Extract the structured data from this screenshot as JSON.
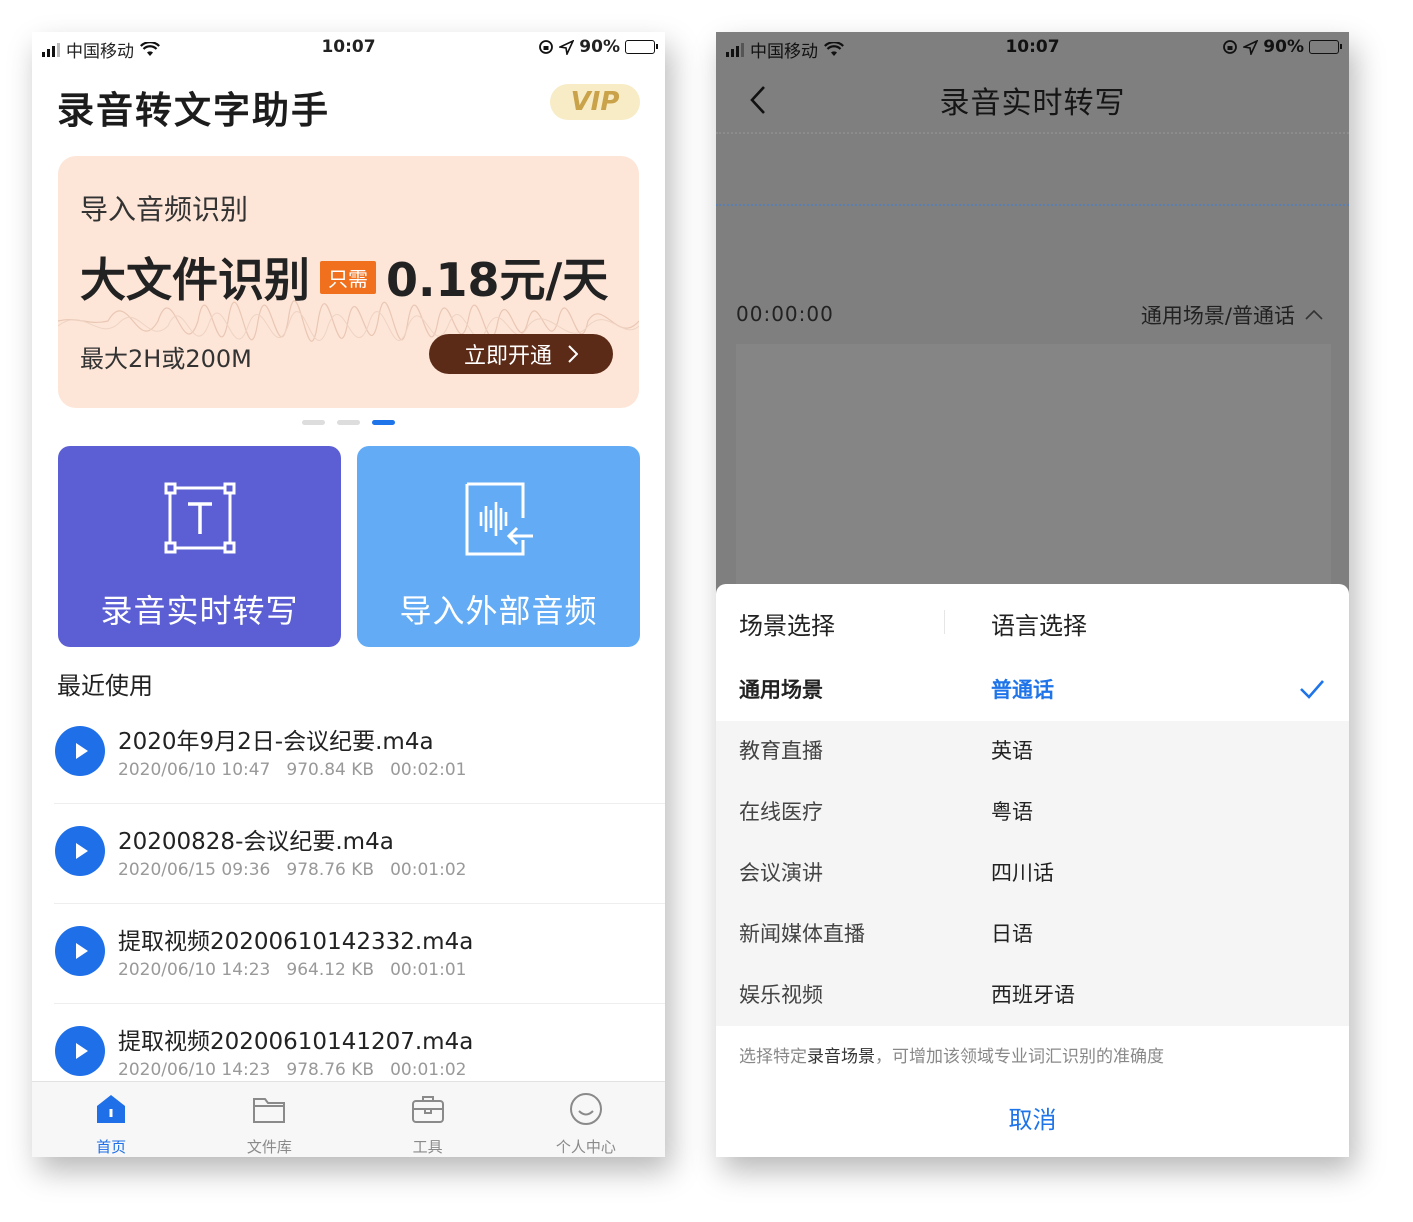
{
  "status_bar": {
    "carrier": "中国移动",
    "time": "10:07",
    "battery": "90%"
  },
  "home": {
    "app_title": "录音转文字助手",
    "vip_badge": "VIP",
    "banner": {
      "subtitle": "导入音频识别",
      "headline": "大文件识别",
      "tag": "只需",
      "price": "0.18元/天",
      "note": "最大2H或200M",
      "button_label": "立即开通"
    },
    "carousel": {
      "count": 3,
      "active_index": 2
    },
    "actions": [
      {
        "label": "录音实时转写",
        "icon": "text-recognition-icon",
        "color": "#5c5fd4"
      },
      {
        "label": "导入外部音频",
        "icon": "audio-import-icon",
        "color": "#63acf5"
      }
    ],
    "recent_title": "最近使用",
    "recent_files": [
      {
        "name": "2020年9月2日-会议纪要.m4a",
        "date": "2020/06/10 10:47",
        "size": "970.84 KB",
        "duration": "00:02:01"
      },
      {
        "name": "20200828-会议纪要.m4a",
        "date": "2020/06/15 09:36",
        "size": "978.76 KB",
        "duration": "00:01:02"
      },
      {
        "name": "提取视频20200610142332.m4a",
        "date": "2020/06/10 14:23",
        "size": "964.12 KB",
        "duration": "00:01:01"
      },
      {
        "name": "提取视频20200610141207.m4a",
        "date": "2020/06/10 14:23",
        "size": "978.76 KB",
        "duration": "00:01:02"
      }
    ],
    "tabs": [
      {
        "label": "首页",
        "icon": "home-icon",
        "active": true
      },
      {
        "label": "文件库",
        "icon": "folder-icon",
        "active": false
      },
      {
        "label": "工具",
        "icon": "toolbox-icon",
        "active": false
      },
      {
        "label": "个人中心",
        "icon": "smile-icon",
        "active": false
      }
    ]
  },
  "transcribe": {
    "title": "录音实时转写",
    "timer": "00:00:00",
    "scene_summary": "通用场景/普通话",
    "sheet": {
      "scene_header": "场景选择",
      "language_header": "语言选择",
      "scenes": [
        "通用场景",
        "教育直播",
        "在线医疗",
        "会议演讲",
        "新闻媒体直播",
        "娱乐视频"
      ],
      "languages": [
        "普通话",
        "英语",
        "粤语",
        "四川话",
        "日语",
        "西班牙语"
      ],
      "selected_scene": "通用场景",
      "selected_language": "普通话",
      "hint_prefix": "选择特定",
      "hint_bold": "录音场景",
      "hint_suffix": "，可增加该领域专业词汇识别的准确度",
      "cancel_label": "取消"
    }
  },
  "colors": {
    "accent": "#1e74e8",
    "banner_bg": "#fde6d8",
    "banner_button": "#5b2b17",
    "tag": "#f0701e"
  }
}
